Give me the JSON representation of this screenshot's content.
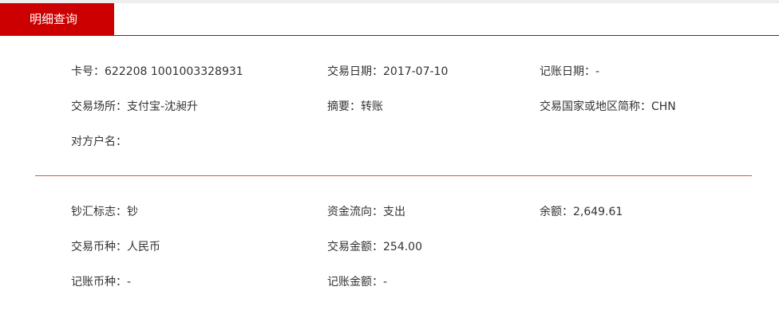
{
  "tab": {
    "label": "明细查询"
  },
  "details": [
    [
      {
        "label": "卡号：",
        "value": "622208 1001003328931"
      },
      {
        "label": "交易日期：",
        "value": "2017-07-10"
      },
      {
        "label": "记账日期：",
        "value": "-"
      }
    ],
    [
      {
        "label": "交易场所：",
        "value": "支付宝-沈昶升"
      },
      {
        "label": "摘要：",
        "value": "转账"
      },
      {
        "label": "交易国家或地区简称：",
        "value": "CHN"
      }
    ],
    [
      {
        "label": "对方户名：",
        "value": ""
      }
    ]
  ],
  "amounts": [
    [
      {
        "label": "钞汇标志：",
        "value": "钞"
      },
      {
        "label": "资金流向：",
        "value": "支出"
      },
      {
        "label": "余额：",
        "value": "2,649.61"
      }
    ],
    [
      {
        "label": "交易币种：",
        "value": "人民币"
      },
      {
        "label": "交易金额：",
        "value": "254.00"
      }
    ],
    [
      {
        "label": "记账币种：",
        "value": "-"
      },
      {
        "label": "记账金额：",
        "value": "-"
      }
    ]
  ]
}
